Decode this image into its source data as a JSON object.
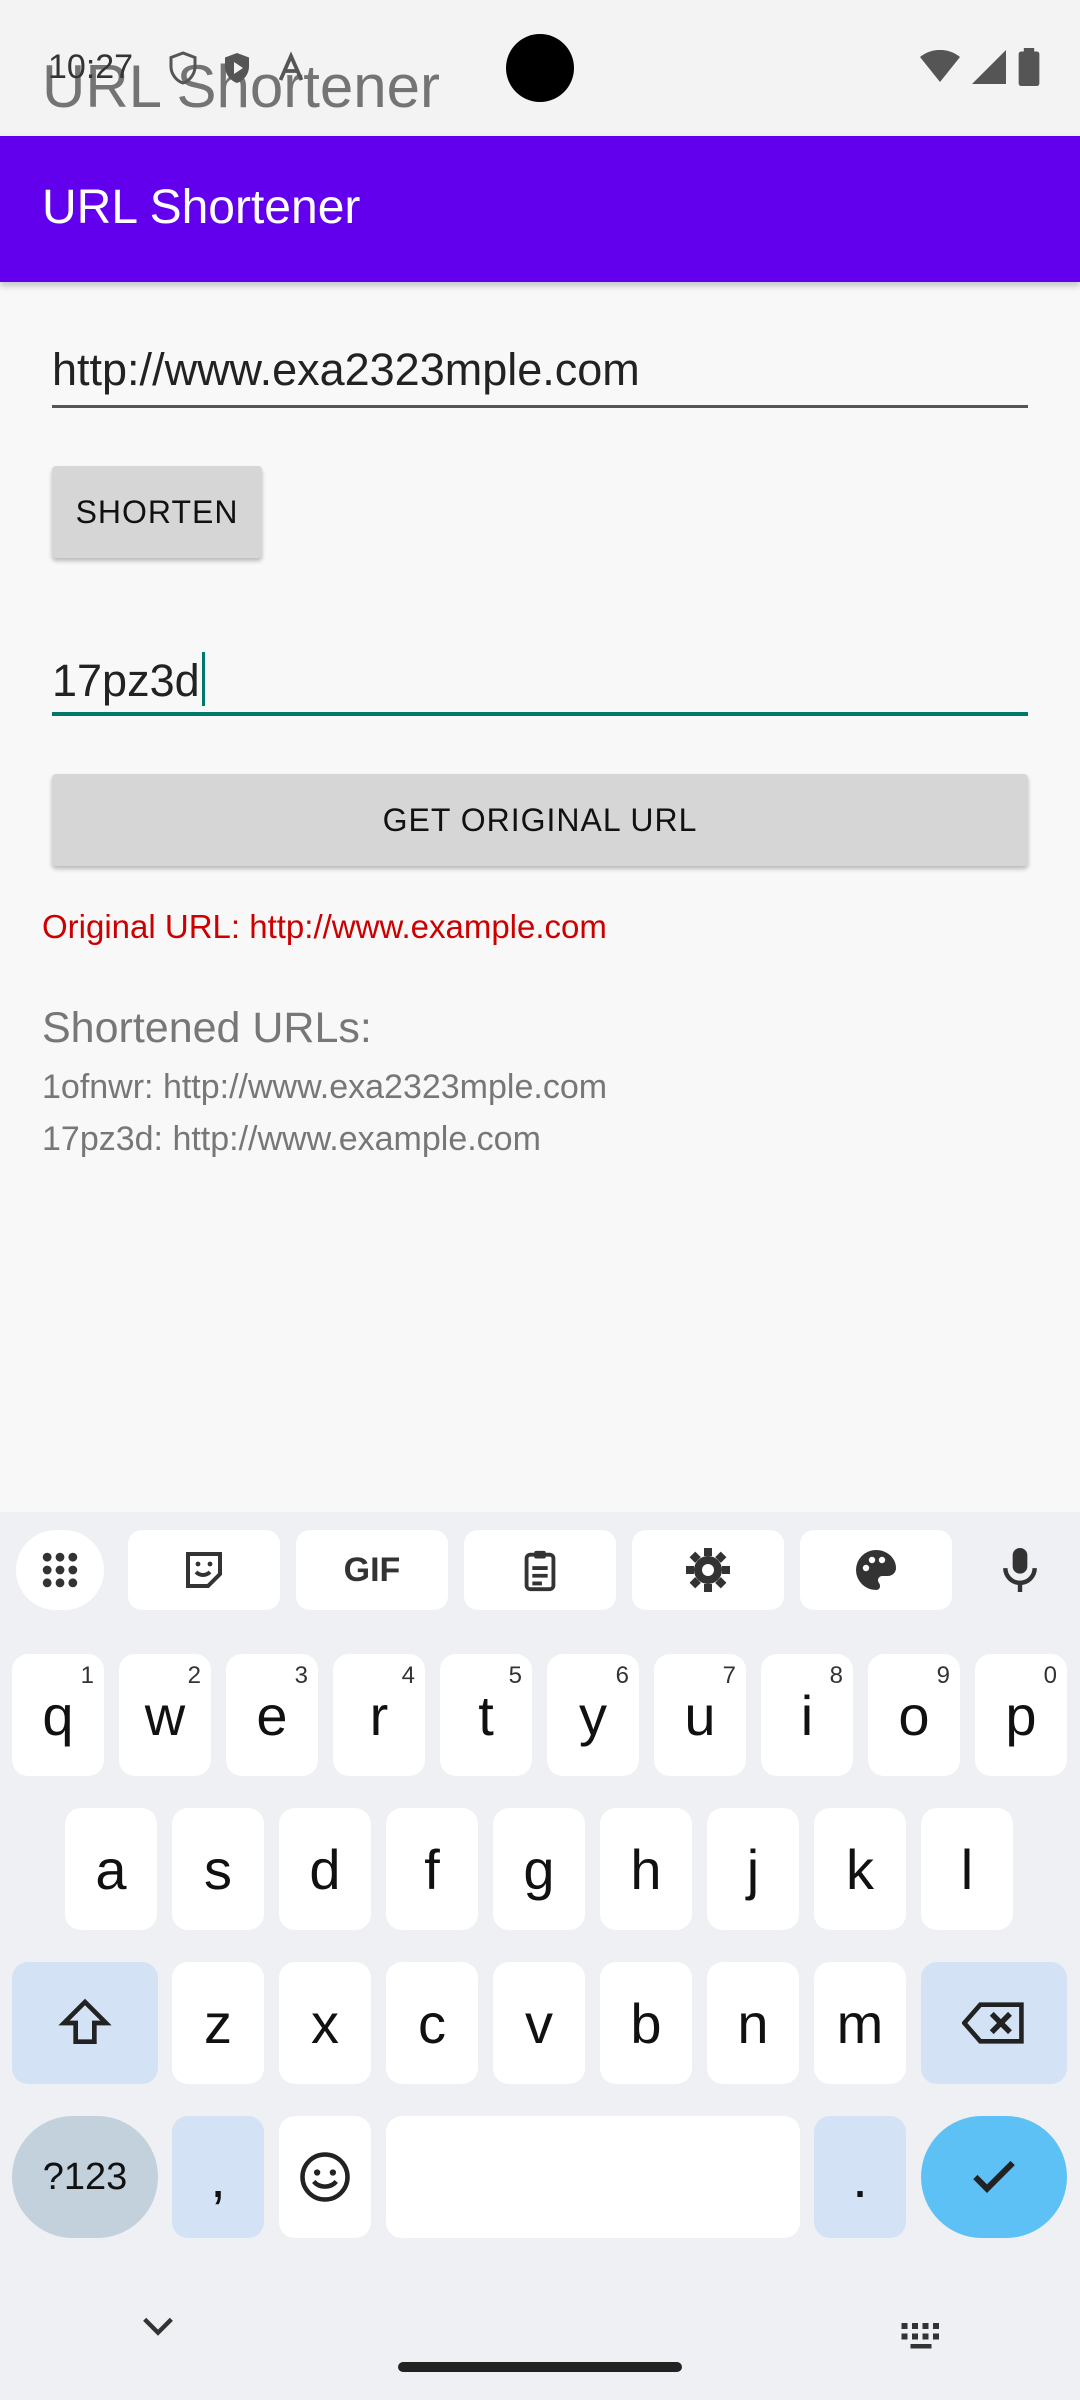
{
  "status_bar": {
    "time": "10:27"
  },
  "window": {
    "ghost_title": "URL Shortener"
  },
  "app_bar": {
    "title": "URL Shortener"
  },
  "form": {
    "url_input_value": "http://www.exa2323mple.com",
    "shorten_button": "SHORTEN",
    "code_input_value": "17pz3d",
    "get_original_button": "GET ORIGINAL URL",
    "result_text": "Original URL: http://www.example.com"
  },
  "history": {
    "title": "Shortened URLs:",
    "items": [
      "1ofnwr: http://www.exa2323mple.com",
      "17pz3d: http://www.example.com"
    ]
  },
  "keyboard": {
    "toolbar": [
      "apps-grid-icon",
      "sticker-icon",
      "gif-label",
      "clipboard-icon",
      "settings-gear-icon",
      "palette-icon",
      "microphone-icon"
    ],
    "gif_label": "GIF",
    "row1": [
      "q",
      "w",
      "e",
      "r",
      "t",
      "y",
      "u",
      "i",
      "o",
      "p"
    ],
    "row1_hints": [
      "1",
      "2",
      "3",
      "4",
      "5",
      "6",
      "7",
      "8",
      "9",
      "0"
    ],
    "row2": [
      "a",
      "s",
      "d",
      "f",
      "g",
      "h",
      "j",
      "k",
      "l"
    ],
    "row3": [
      "z",
      "x",
      "c",
      "v",
      "b",
      "n",
      "m"
    ],
    "symbols_key": "?123",
    "comma_key": ",",
    "period_key": "."
  },
  "colors": {
    "app_bar": "#6200ee",
    "result_text": "#cc0000",
    "focus_underline": "#00796b"
  }
}
